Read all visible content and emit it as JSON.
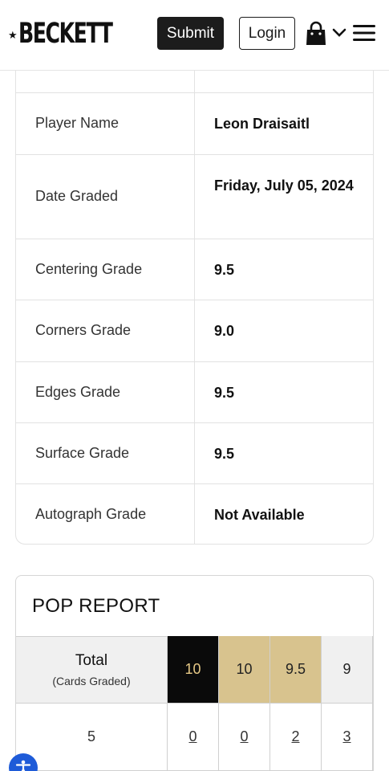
{
  "header": {
    "logo_text": "BECKETT",
    "submit_label": "Submit",
    "login_label": "Login"
  },
  "details": {
    "rows": [
      {
        "label": "Player Name",
        "value": "Leon Draisaitl"
      },
      {
        "label": "Date Graded",
        "value": "Friday, July 05, 2024"
      },
      {
        "label": "Centering Grade",
        "value": "9.5"
      },
      {
        "label": "Corners Grade",
        "value": "9.0"
      },
      {
        "label": "Edges Grade",
        "value": "9.5"
      },
      {
        "label": "Surface Grade",
        "value": "9.5"
      },
      {
        "label": "Autograph Grade",
        "value": "Not Available"
      }
    ]
  },
  "pop_report": {
    "title": "POP REPORT",
    "total_label": "Total",
    "total_sublabel": "(Cards Graded)",
    "grade_headers": [
      "10",
      "10",
      "9.5",
      "9"
    ],
    "total_count": "5",
    "grade_counts": [
      "0",
      "0",
      "2",
      "3"
    ]
  },
  "colors": {
    "brand_dark": "#1c1c1c",
    "pristine_black": "#0a0a0a",
    "gold": "#d8c38e",
    "accessibility_blue": "#1e5bd8"
  }
}
